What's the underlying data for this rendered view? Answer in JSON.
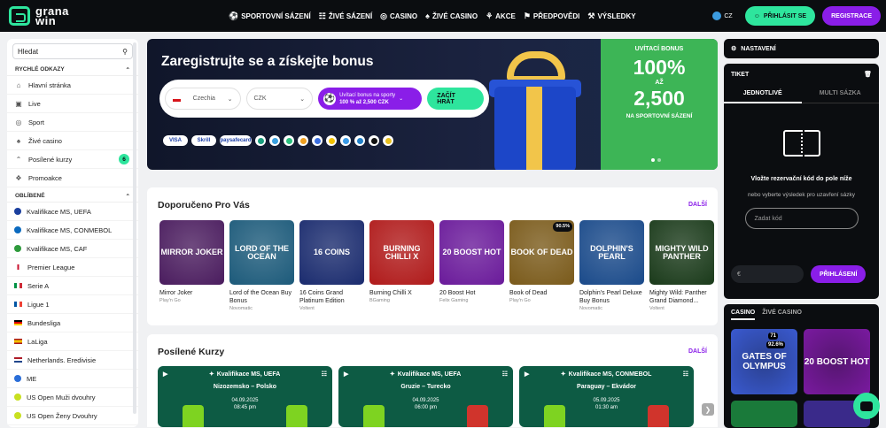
{
  "brand": {
    "line1": "grana",
    "line2": "win",
    "accent": "#2ee59d",
    "purple": "#8a1ee8"
  },
  "nav": [
    {
      "label": "SPORTOVNÍ SÁZENÍ",
      "icon": "soccer-ball-icon"
    },
    {
      "label": "ŽIVÉ SÁZENÍ",
      "icon": "live-chart-icon"
    },
    {
      "label": "CASINO",
      "icon": "casino-chip-icon"
    },
    {
      "label": "ŽIVÉ CASINO",
      "icon": "live-casino-icon"
    },
    {
      "label": "AKCE",
      "icon": "gift-icon"
    },
    {
      "label": "PŘEDPOVĚDI",
      "icon": "predictions-icon"
    },
    {
      "label": "VÝSLEDKY",
      "icon": "results-icon"
    }
  ],
  "header": {
    "lang": "CZ",
    "login": "PŘIHLÁSIT SE",
    "register": "REGISTRACE"
  },
  "sidebar": {
    "search_placeholder": "Hledat",
    "quick_title": "RYCHLÉ ODKAZY",
    "quick": [
      {
        "label": "Hlavní stránka",
        "icon": "home-icon"
      },
      {
        "label": "Live",
        "icon": "live-icon"
      },
      {
        "label": "Sport",
        "icon": "sport-icon"
      },
      {
        "label": "Živé casino",
        "icon": "live-casino-icon"
      },
      {
        "label": "Posílené kurzy",
        "icon": "boost-icon",
        "count": "6"
      },
      {
        "label": "Promoakce",
        "icon": "promo-icon"
      }
    ],
    "fav_title": "OBLÍBENÉ",
    "favorites": [
      {
        "label": "Kvalifikace MS, UEFA",
        "icon": "uefa-icon"
      },
      {
        "label": "Kvalifikace MS, CONMEBOL",
        "icon": "conmebol-icon"
      },
      {
        "label": "Kvalifikace MS, CAF",
        "icon": "caf-icon"
      },
      {
        "label": "Premier League",
        "icon": "england-flag-icon"
      },
      {
        "label": "Serie A",
        "icon": "italy-flag-icon"
      },
      {
        "label": "Ligue 1",
        "icon": "france-flag-icon"
      },
      {
        "label": "Bundesliga",
        "icon": "germany-flag-icon"
      },
      {
        "label": "LaLiga",
        "icon": "spain-flag-icon"
      },
      {
        "label": "Netherlands. Eredivisie",
        "icon": "netherlands-flag-icon"
      },
      {
        "label": "ME",
        "icon": "euro-icon"
      },
      {
        "label": "US Open Muži dvouhry",
        "icon": "tennis-icon"
      },
      {
        "label": "US Open Ženy Dvouhry",
        "icon": "tennis-icon"
      }
    ]
  },
  "hero": {
    "title": "Zaregistrujte se a získejte bonus",
    "country": "Czechia",
    "currency": "CZK",
    "bonus_line1": "Uvítací bonus na sporty",
    "bonus_line2": "100 % až 2,500 CZK",
    "cta": "ZAČÍT HRÁT",
    "payments": [
      "VISA",
      "Skrill",
      "paysafecard"
    ],
    "coins": [
      "#1a9e7e",
      "#3aa0e0",
      "#2bbf7f",
      "#f0a020",
      "#3b6ee0",
      "#f2c200",
      "#3b9be8",
      "#2280c8",
      "#111",
      "#e8c020"
    ],
    "promo_line1": "UVÍTACÍ BONUS",
    "promo_line2": "100%",
    "promo_line3": "AŽ",
    "promo_line4": "2,500",
    "promo_line5": "NA SPORTOVNÍ SÁZENÍ"
  },
  "reco": {
    "title": "Doporučeno Pro Vás",
    "more": "DALŠÍ",
    "games": [
      {
        "name": "Mirror Joker",
        "provider": "Play'n Go",
        "art": "MIRROR JOKER",
        "bg": "#4a1c5e"
      },
      {
        "name": "Lord of the Ocean Buy Bonus",
        "provider": "Novomatic",
        "art": "LORD OF THE OCEAN",
        "bg": "#1c5a7a"
      },
      {
        "name": "16 Coins Grand Platinum Edition",
        "provider": "Voltent",
        "art": "16 COINS",
        "bg": "#1a2b6e"
      },
      {
        "name": "Burning Chilli X",
        "provider": "BGaming",
        "art": "BURNING CHILLI X",
        "bg": "#b01a1a"
      },
      {
        "name": "20 Boost Hot",
        "provider": "Felix Gaming",
        "art": "20 BOOST HOT",
        "bg": "#6a1a9a"
      },
      {
        "name": "Book of Dead",
        "provider": "Play'n Go",
        "art": "BOOK OF DEAD",
        "bg": "#7a5a1a",
        "pct": "90.5%"
      },
      {
        "name": "Dolphin's Pearl Deluxe Buy Bonus",
        "provider": "Novomatic",
        "art": "DOLPHIN'S PEARL",
        "bg": "#1a4a8a"
      },
      {
        "name": "Mighty Wild: Panther Grand Diamond...",
        "provider": "Voltent",
        "art": "MIGHTY WILD PANTHER",
        "bg": "#1a3a1a"
      }
    ]
  },
  "boosted": {
    "title": "Posílené Kurzy",
    "more": "DALŠÍ",
    "matches": [
      {
        "league": "Kvalifikace MS, UEFA",
        "teams": "Nizozemsko – Polsko",
        "date": "04.09.2025",
        "time": "08:45 pm",
        "home": "#7ed321",
        "away": "#7ed321"
      },
      {
        "league": "Kvalifikace MS, UEFA",
        "teams": "Gruzie – Turecko",
        "date": "04.09.2025",
        "time": "06:00 pm",
        "home": "#7ed321",
        "away": "#d0342c"
      },
      {
        "league": "Kvalifikace MS, CONMEBOL",
        "teams": "Paraguay – Ekvádor",
        "date": "05.09.2025",
        "time": "01:30 am",
        "home": "#7ed321",
        "away": "#d0342c"
      }
    ]
  },
  "right": {
    "settings": "NASTAVENÍ",
    "ticket": "TIKET",
    "tab_single": "JEDNOTLIVÉ",
    "tab_multi": "MULTI SÁZKA",
    "msg": "Vložte rezervační kód do pole níže",
    "sub": "nebo vyberte výsledek pro uzavření sázky",
    "code_placeholder": "Zadat kód",
    "currency": "€",
    "login": "PŘIHLÁSENÍ",
    "casino_tab": "CASINO",
    "live_casino_tab": "ŽIVÉ CASINO",
    "casino_thumbs": [
      {
        "art": "GATES OF OLYMPUS",
        "bg": "#3a5ad0",
        "v1": "71",
        "v2": "92.6%"
      },
      {
        "art": "20 BOOST HOT",
        "bg": "#7a1aa0"
      }
    ]
  }
}
